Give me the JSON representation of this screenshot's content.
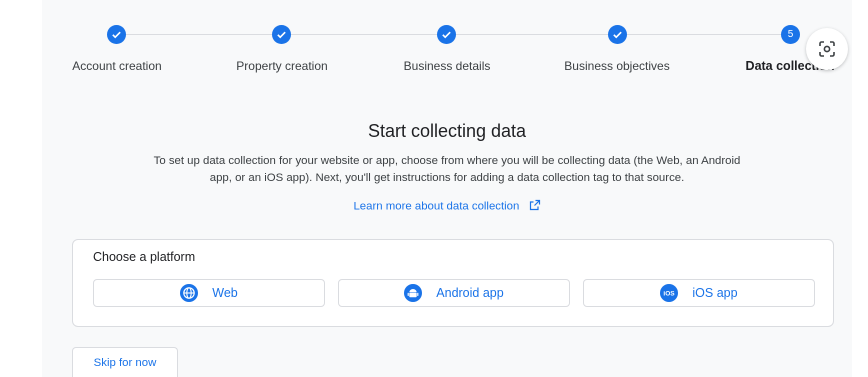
{
  "stepper": {
    "steps": [
      {
        "label": "Account creation",
        "state": "done"
      },
      {
        "label": "Property creation",
        "state": "done"
      },
      {
        "label": "Business details",
        "state": "done"
      },
      {
        "label": "Business objectives",
        "state": "done"
      },
      {
        "label": "Data collection",
        "state": "current",
        "number": "5"
      }
    ]
  },
  "main": {
    "title": "Start collecting data",
    "description_line1": "To set up data collection for your website or app, choose from where you will be collecting data (the Web, an Android",
    "description_line2": "app, or an iOS app). Next, you'll get instructions for adding a data collection tag to that source.",
    "learn_more": "Learn more about data collection"
  },
  "platform_card": {
    "title": "Choose a platform",
    "options": [
      {
        "label": "Web",
        "icon": "globe-icon"
      },
      {
        "label": "Android app",
        "icon": "android-icon"
      },
      {
        "label": "iOS app",
        "icon": "ios-icon"
      }
    ]
  },
  "footer": {
    "skip_label": "Skip for now"
  },
  "colors": {
    "accent": "#1a73e8",
    "background": "#f8f9fa",
    "border": "#dadce0"
  }
}
